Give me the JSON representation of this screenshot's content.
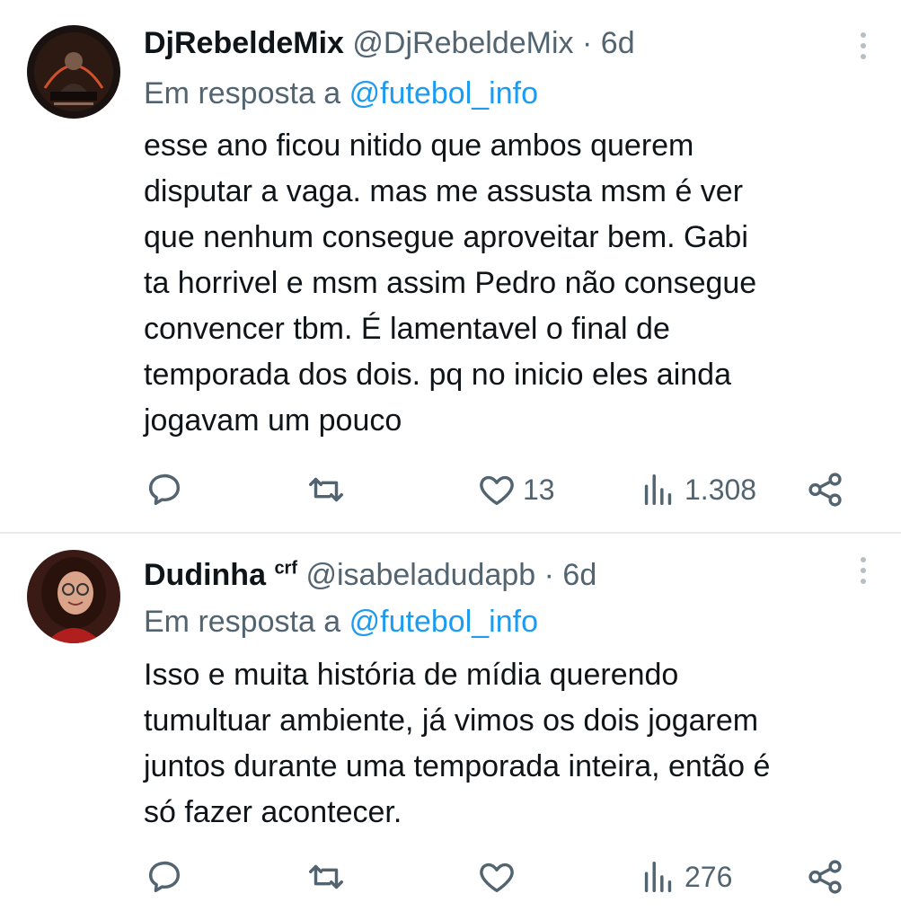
{
  "tweets": [
    {
      "display_name": "DjRebeldeMix",
      "badge": "",
      "handle": "@DjRebeldeMix",
      "separator": "·",
      "time": "6d",
      "reply_prefix": "Em resposta a",
      "reply_mention": "@futebol_info",
      "body_lines": [
        "esse ano ficou nitido que ambos querem",
        "disputar a vaga. mas me assusta msm é ver",
        "que nenhum consegue aproveitar bem. Gabi",
        "ta horrivel e msm assim Pedro não consegue",
        "convencer tbm. É lamentavel o final de",
        "temporada dos dois. pq no inicio eles ainda",
        "jogavam um pouco"
      ],
      "likes": "13",
      "views": "1.308"
    },
    {
      "display_name": "Dudinha",
      "badge": "crf",
      "handle": "@isabeladudapb",
      "separator": "·",
      "time": "6d",
      "reply_prefix": "Em resposta a",
      "reply_mention": "@futebol_info",
      "body_lines": [
        "Isso e muita história de mídia querendo",
        "tumultuar ambiente, já vimos os dois jogarem",
        "juntos durante uma temporada inteira, então é",
        "só fazer acontecer."
      ],
      "likes": "",
      "views": "276"
    }
  ],
  "icons": {
    "reply": "comment-icon",
    "retweet": "retweet-icon",
    "like": "heart-icon",
    "views": "views-icon",
    "share": "share-icon",
    "more": "more-vertical-icon"
  },
  "colors": {
    "text": "#0f1419",
    "secondary": "#536471",
    "link": "#1d9bf0",
    "divider": "#e7e9ea"
  }
}
